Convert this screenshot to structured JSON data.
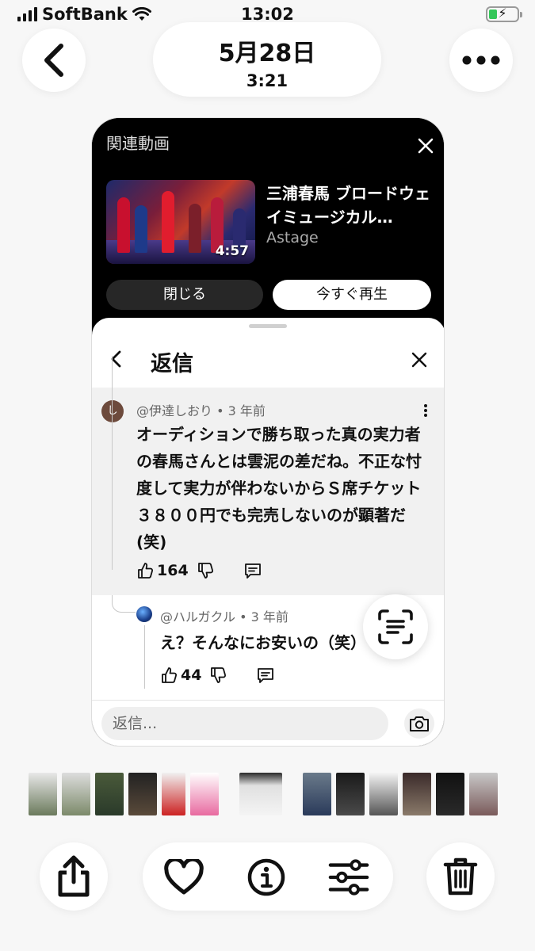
{
  "status_bar": {
    "carrier": "SoftBank",
    "time": "13:02"
  },
  "header": {
    "date": "5月28日",
    "time": "3:21"
  },
  "related": {
    "title": "関連動画",
    "video_title": "三浦春馬 ブロードウェイミュージカル…",
    "channel": "Astage",
    "duration": "4:57",
    "close_label": "閉じる",
    "play_label": "今すぐ再生"
  },
  "reply_panel": {
    "title": "返信",
    "comment": {
      "avatar_letter": "し",
      "author": "@伊達しおり • 3 年前",
      "text": "オーディションで勝ち取った真の実力者の春馬さんとは雲泥の差だね。不正な忖度して実力が伴わないからＳ席チケット３８００円でも完売しないのが顕著だ (笑)",
      "likes": "164"
    },
    "reply": {
      "author": "@ハルガクル • 3 年前",
      "text": "え？そんなにお安いの（笑）",
      "likes": "44"
    },
    "input_placeholder": "返信..."
  },
  "icons": {
    "back": "chevron-left-icon",
    "more": "more-horizontal-icon",
    "share": "share-icon",
    "favorite": "heart-icon",
    "info": "info-icon",
    "adjust": "sliders-icon",
    "delete": "trash-icon",
    "scan": "live-text-icon"
  }
}
